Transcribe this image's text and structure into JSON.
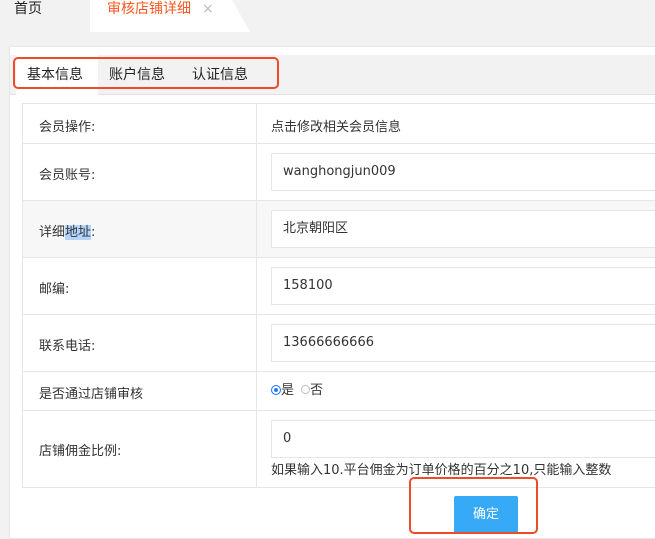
{
  "topbar": {
    "home_label": "首页",
    "detail_tab_label": "审核店铺详细",
    "close_icon": "×"
  },
  "tabs": [
    {
      "label": "基本信息",
      "active": true
    },
    {
      "label": "账户信息",
      "active": false
    },
    {
      "label": "认证信息",
      "active": false
    }
  ],
  "form": {
    "member_op": {
      "label": "会员操作:",
      "value": "点击修改相关会员信息"
    },
    "account": {
      "label": "会员账号:",
      "value": "wanghongjun009"
    },
    "address": {
      "label_prefix": "详细",
      "label_highlight": "地址",
      "label_suffix": ":",
      "value": "北京朝阳区"
    },
    "zipcode": {
      "label": "邮编:",
      "value": "158100"
    },
    "phone": {
      "label": "联系电话:",
      "value": "13666666666"
    },
    "approve": {
      "label": "是否通过店铺审核",
      "options": [
        "是",
        "否"
      ],
      "selected": "是"
    },
    "commission": {
      "label": "店铺佣金比例:",
      "value": "0",
      "hint": "如果输入10.平台佣金为订单价格的百分之10,只能输入整数"
    }
  },
  "confirm_button": "确定",
  "colors": {
    "accent_tab": "#ff5722",
    "highlight_box": "#ef4b2b",
    "button": "#36a9f7",
    "radio": "#1e7bf0"
  }
}
